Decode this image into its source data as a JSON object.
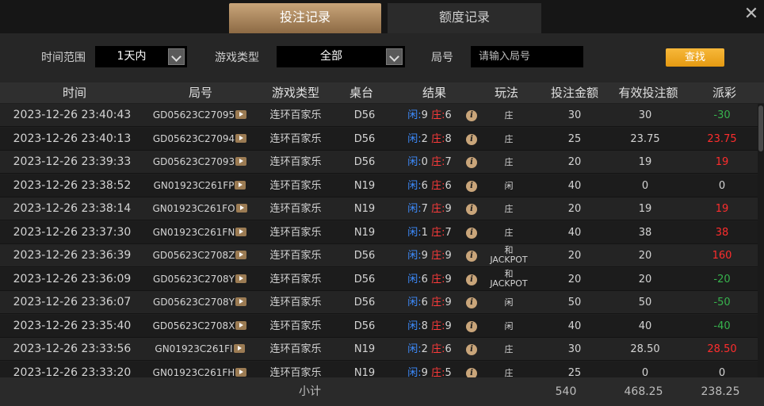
{
  "tabs": {
    "active": "投注记录",
    "inactive": "额度记录"
  },
  "close_glyph": "✕",
  "filters": {
    "time_label": "时间范围",
    "time_value": "1天内",
    "game_label": "游戏类型",
    "game_value": "全部",
    "round_label": "局号",
    "round_placeholder": "请输入局号",
    "search_label": "查找"
  },
  "table": {
    "headers": [
      "时间",
      "局号",
      "游戏类型",
      "桌台",
      "结果",
      "玩法",
      "投注金额",
      "有效投注额",
      "派彩"
    ],
    "player_label": "闲:",
    "banker_label": "庄:",
    "rows": [
      {
        "time": "2023-12-26 23:40:43",
        "id": "GD05623C27095",
        "game": "连环百家乐",
        "table": "D56",
        "player": "9",
        "banker": "6",
        "bet": "庄",
        "amount": "30",
        "valid": "30",
        "payout": "-30",
        "sign": "neg"
      },
      {
        "time": "2023-12-26 23:40:13",
        "id": "GD05623C27094",
        "game": "连环百家乐",
        "table": "D56",
        "player": "2",
        "banker": "8",
        "bet": "庄",
        "amount": "25",
        "valid": "23.75",
        "payout": "23.75",
        "sign": "pos"
      },
      {
        "time": "2023-12-26 23:39:33",
        "id": "GD05623C27093",
        "game": "连环百家乐",
        "table": "D56",
        "player": "0",
        "banker": "7",
        "bet": "庄",
        "amount": "20",
        "valid": "19",
        "payout": "19",
        "sign": "pos"
      },
      {
        "time": "2023-12-26 23:38:52",
        "id": "GN01923C261FP",
        "game": "连环百家乐",
        "table": "N19",
        "player": "6",
        "banker": "6",
        "bet": "闲",
        "amount": "40",
        "valid": "0",
        "payout": "0",
        "sign": "zero"
      },
      {
        "time": "2023-12-26 23:38:14",
        "id": "GN01923C261FO",
        "game": "连环百家乐",
        "table": "N19",
        "player": "7",
        "banker": "9",
        "bet": "庄",
        "amount": "20",
        "valid": "19",
        "payout": "19",
        "sign": "pos"
      },
      {
        "time": "2023-12-26 23:37:30",
        "id": "GN01923C261FN",
        "game": "连环百家乐",
        "table": "N19",
        "player": "1",
        "banker": "7",
        "bet": "庄",
        "amount": "40",
        "valid": "38",
        "payout": "38",
        "sign": "pos"
      },
      {
        "time": "2023-12-26 23:36:39",
        "id": "GD05623C2708Z",
        "game": "连环百家乐",
        "table": "D56",
        "player": "9",
        "banker": "9",
        "bet": "和",
        "bet2": "JACKPOT",
        "amount": "20",
        "valid": "20",
        "payout": "160",
        "sign": "pos"
      },
      {
        "time": "2023-12-26 23:36:09",
        "id": "GD05623C2708Y",
        "game": "连环百家乐",
        "table": "D56",
        "player": "6",
        "banker": "9",
        "bet": "和",
        "bet2": "JACKPOT",
        "amount": "20",
        "valid": "20",
        "payout": "-20",
        "sign": "neg"
      },
      {
        "time": "2023-12-26 23:36:07",
        "id": "GD05623C2708Y",
        "game": "连环百家乐",
        "table": "D56",
        "player": "6",
        "banker": "9",
        "bet": "闲",
        "amount": "50",
        "valid": "50",
        "payout": "-50",
        "sign": "neg"
      },
      {
        "time": "2023-12-26 23:35:40",
        "id": "GD05623C2708X",
        "game": "连环百家乐",
        "table": "D56",
        "player": "8",
        "banker": "9",
        "bet": "闲",
        "amount": "40",
        "valid": "40",
        "payout": "-40",
        "sign": "neg"
      },
      {
        "time": "2023-12-26 23:33:56",
        "id": "GN01923C261FI",
        "game": "连环百家乐",
        "table": "N19",
        "player": "2",
        "banker": "6",
        "bet": "庄",
        "amount": "30",
        "valid": "28.50",
        "payout": "28.50",
        "sign": "pos"
      },
      {
        "time": "2023-12-26 23:33:20",
        "id": "GN01923C261FH",
        "game": "连环百家乐",
        "table": "N19",
        "player": "9",
        "banker": "5",
        "bet": "庄",
        "amount": "25",
        "valid": "0",
        "payout": "0",
        "sign": "zero"
      }
    ]
  },
  "footer": {
    "label": "小计",
    "amount": "540",
    "valid": "468.25",
    "payout": "238.25"
  },
  "colors": {
    "accent": "#c9a57a",
    "player": "#3d8cff",
    "banker": "#ff3b3b",
    "win": "#ff2d2d",
    "loss": "#37b24d",
    "button": "#f2a623"
  }
}
